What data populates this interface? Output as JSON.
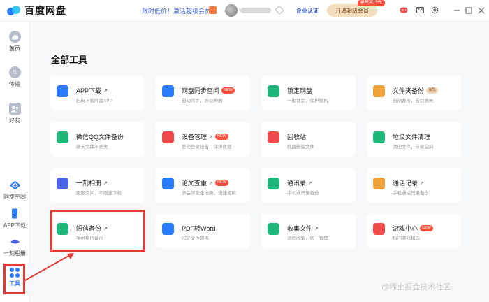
{
  "app": {
    "name": "百度网盘"
  },
  "header": {
    "promo": "限时低价！激活超级会员",
    "enterprise": "企业认证",
    "open_vip": "开通超级会员",
    "open_vip_tag": "最高减15元"
  },
  "sidebar": {
    "items": [
      {
        "label": "首页",
        "icon": "cloud-icon"
      },
      {
        "label": "传输",
        "icon": "transfer-icon"
      },
      {
        "label": "好友",
        "icon": "friends-icon"
      },
      {
        "label": "同步空间",
        "icon": "sync-icon"
      },
      {
        "label": "APP下载",
        "icon": "phone-icon"
      },
      {
        "label": "一刻相册",
        "icon": "album-icon"
      },
      {
        "label": "工具",
        "icon": "tools-icon",
        "active": true
      }
    ]
  },
  "main": {
    "title": "全部工具",
    "tools": [
      {
        "name": "APP下载",
        "desc": "扫码下载网盘APP",
        "arrow": "↗",
        "badge": "",
        "color": "#2b7bff"
      },
      {
        "name": "网盘同步空间",
        "desc": "自动同步，办公神器",
        "arrow": "",
        "badge": "NEW",
        "color": "#2b7bff"
      },
      {
        "name": "锁定网盘",
        "desc": "一键锁定，保护隐私",
        "arrow": "",
        "badge": "",
        "color": "#1fb87a"
      },
      {
        "name": "文件夹备份",
        "desc": "自动备份，告别丢失",
        "arrow": "",
        "badge": "会员",
        "color": "#f0a23a"
      },
      {
        "name": "微信QQ文件备份",
        "desc": "聊天文件不丢失",
        "arrow": "",
        "badge": "",
        "color": "#1fb87a"
      },
      {
        "name": "设备管理",
        "desc": "管理登录设备，保护数据",
        "arrow": "↗",
        "badge": "NEW",
        "color": "#ef4b4b"
      },
      {
        "name": "回收站",
        "desc": "找回删除文件",
        "arrow": "",
        "badge": "",
        "color": "#ef4b4b"
      },
      {
        "name": "垃圾文件清理",
        "desc": "清理文件，节省空间",
        "arrow": "",
        "badge": "",
        "color": "#1fb87a"
      },
      {
        "name": "一刻相册",
        "desc": "无限空间，不限速下载",
        "arrow": "↗",
        "badge": "",
        "color": "#4a63e6"
      },
      {
        "name": "论文查重",
        "desc": "多品牌安全准确，快速自助",
        "arrow": "↗",
        "badge": "NEW",
        "color": "#2b7bff"
      },
      {
        "name": "通讯录",
        "desc": "手机通讯录备份",
        "arrow": "↗",
        "badge": "",
        "color": "#1fb87a"
      },
      {
        "name": "通话记录",
        "desc": "手机通话记录备份",
        "arrow": "↗",
        "badge": "",
        "color": "#f0a23a"
      },
      {
        "name": "短信备份",
        "desc": "手机短信备份",
        "arrow": "↗",
        "badge": "",
        "color": "#1fb87a"
      },
      {
        "name": "PDF转Word",
        "desc": "PDF文件转换",
        "arrow": "",
        "badge": "",
        "color": "#2b7bff"
      },
      {
        "name": "收集文件",
        "desc": "远程收集，统一管理",
        "arrow": "↗",
        "badge": "",
        "color": "#1fb87a"
      },
      {
        "name": "游戏中心",
        "desc": "热门游戏精选",
        "arrow": "",
        "badge": "NEW",
        "color": "#ef4b4b"
      }
    ]
  },
  "watermark": "@稀土掘金技术社区"
}
